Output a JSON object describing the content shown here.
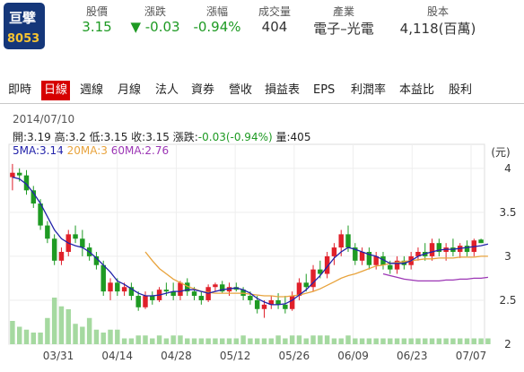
{
  "stock": {
    "name": "亘擘",
    "code": "8053"
  },
  "header": [
    {
      "label": "股價",
      "value": "3.15"
    },
    {
      "label": "漲跌",
      "value": "▼ -0.03"
    },
    {
      "label": "漲幅",
      "value": "-0.94%"
    },
    {
      "label": "成交量",
      "value": "404"
    },
    {
      "label": "產業",
      "value": "電子–光電"
    },
    {
      "label": "股本",
      "value": "4,118(百萬)"
    }
  ],
  "tabs": [
    "即時",
    "日線",
    "週線",
    "月線",
    "法人",
    "資券",
    "營收",
    "損益表",
    "EPS",
    "利潤率",
    "本益比",
    "股利"
  ],
  "active_tab": "日線",
  "ohlc": {
    "date": "2014/07/10",
    "line_open": "開:3.19",
    "line_high": "高:3.2",
    "line_low": "低:3.15",
    "line_close": "收:3.15",
    "line_change_label": "漲跌:",
    "line_change_value": "-0.03(-0.94%)",
    "line_volume": "量:405"
  },
  "ma": {
    "ma5": "5MA:3.14",
    "ma20": "20MA:3",
    "ma60": "60MA:2.76"
  },
  "colors": {
    "up": "#e0202a",
    "down": "#1e9a23",
    "ma5": "#2222aa",
    "ma20": "#e8a33c",
    "ma60": "#9c36b5",
    "volume": "#a5d9a0"
  },
  "chart_data": {
    "type": "candlestick",
    "unit_label": "(元)",
    "y_ticks": [
      "4",
      "3.5",
      "3",
      "2.5",
      "2"
    ],
    "ylim": [
      2,
      4.1
    ],
    "x_tick_labels": [
      "03/31",
      "04/14",
      "04/28",
      "05/12",
      "05/26",
      "06/09",
      "06/23",
      "07/07"
    ],
    "candles": [
      {
        "o": 3.9,
        "h": 4.05,
        "l": 3.75,
        "c": 3.95
      },
      {
        "o": 3.95,
        "h": 4.0,
        "l": 3.85,
        "c": 3.92
      },
      {
        "o": 3.92,
        "h": 3.98,
        "l": 3.7,
        "c": 3.75
      },
      {
        "o": 3.75,
        "h": 3.8,
        "l": 3.55,
        "c": 3.6
      },
      {
        "o": 3.6,
        "h": 3.65,
        "l": 3.3,
        "c": 3.35
      },
      {
        "o": 3.35,
        "h": 3.4,
        "l": 3.15,
        "c": 3.2
      },
      {
        "o": 3.2,
        "h": 3.25,
        "l": 2.9,
        "c": 2.95
      },
      {
        "o": 2.95,
        "h": 3.1,
        "l": 2.9,
        "c": 3.05
      },
      {
        "o": 3.05,
        "h": 3.3,
        "l": 3.0,
        "c": 3.25
      },
      {
        "o": 3.25,
        "h": 3.35,
        "l": 3.15,
        "c": 3.2
      },
      {
        "o": 3.2,
        "h": 3.3,
        "l": 3.0,
        "c": 3.1
      },
      {
        "o": 3.1,
        "h": 3.15,
        "l": 2.95,
        "c": 3.0
      },
      {
        "o": 3.0,
        "h": 3.05,
        "l": 2.85,
        "c": 2.9
      },
      {
        "o": 2.9,
        "h": 2.95,
        "l": 2.55,
        "c": 2.6
      },
      {
        "o": 2.6,
        "h": 2.75,
        "l": 2.5,
        "c": 2.7
      },
      {
        "o": 2.7,
        "h": 2.75,
        "l": 2.55,
        "c": 2.6
      },
      {
        "o": 2.6,
        "h": 2.7,
        "l": 2.55,
        "c": 2.65
      },
      {
        "o": 2.65,
        "h": 2.7,
        "l": 2.5,
        "c": 2.55
      },
      {
        "o": 2.55,
        "h": 2.6,
        "l": 2.38,
        "c": 2.42
      },
      {
        "o": 2.42,
        "h": 2.6,
        "l": 2.4,
        "c": 2.55
      },
      {
        "o": 2.55,
        "h": 2.6,
        "l": 2.45,
        "c": 2.5
      },
      {
        "o": 2.5,
        "h": 2.65,
        "l": 2.48,
        "c": 2.62
      },
      {
        "o": 2.62,
        "h": 2.7,
        "l": 2.55,
        "c": 2.6
      },
      {
        "o": 2.6,
        "h": 2.7,
        "l": 2.5,
        "c": 2.55
      },
      {
        "o": 2.55,
        "h": 2.72,
        "l": 2.5,
        "c": 2.7
      },
      {
        "o": 2.7,
        "h": 2.75,
        "l": 2.55,
        "c": 2.6
      },
      {
        "o": 2.6,
        "h": 2.65,
        "l": 2.5,
        "c": 2.55
      },
      {
        "o": 2.55,
        "h": 2.6,
        "l": 2.45,
        "c": 2.5
      },
      {
        "o": 2.5,
        "h": 2.68,
        "l": 2.48,
        "c": 2.65
      },
      {
        "o": 2.65,
        "h": 2.7,
        "l": 2.6,
        "c": 2.68
      },
      {
        "o": 2.68,
        "h": 2.72,
        "l": 2.58,
        "c": 2.6
      },
      {
        "o": 2.6,
        "h": 2.7,
        "l": 2.55,
        "c": 2.65
      },
      {
        "o": 2.65,
        "h": 2.7,
        "l": 2.6,
        "c": 2.62
      },
      {
        "o": 2.62,
        "h": 2.65,
        "l": 2.5,
        "c": 2.55
      },
      {
        "o": 2.55,
        "h": 2.6,
        "l": 2.45,
        "c": 2.5
      },
      {
        "o": 2.5,
        "h": 2.55,
        "l": 2.35,
        "c": 2.4
      },
      {
        "o": 2.4,
        "h": 2.5,
        "l": 2.3,
        "c": 2.45
      },
      {
        "o": 2.45,
        "h": 2.55,
        "l": 2.4,
        "c": 2.5
      },
      {
        "o": 2.5,
        "h": 2.58,
        "l": 2.4,
        "c": 2.45
      },
      {
        "o": 2.45,
        "h": 2.55,
        "l": 2.35,
        "c": 2.4
      },
      {
        "o": 2.4,
        "h": 2.6,
        "l": 2.38,
        "c": 2.55
      },
      {
        "o": 2.55,
        "h": 2.75,
        "l": 2.5,
        "c": 2.7
      },
      {
        "o": 2.7,
        "h": 2.8,
        "l": 2.6,
        "c": 2.65
      },
      {
        "o": 2.65,
        "h": 2.9,
        "l": 2.6,
        "c": 2.85
      },
      {
        "o": 2.85,
        "h": 2.95,
        "l": 2.75,
        "c": 2.8
      },
      {
        "o": 2.8,
        "h": 3.05,
        "l": 2.75,
        "c": 3.0
      },
      {
        "o": 3.0,
        "h": 3.15,
        "l": 2.9,
        "c": 3.1
      },
      {
        "o": 3.1,
        "h": 3.3,
        "l": 3.0,
        "c": 3.25
      },
      {
        "o": 3.25,
        "h": 3.35,
        "l": 3.05,
        "c": 3.1
      },
      {
        "o": 3.1,
        "h": 3.15,
        "l": 2.9,
        "c": 2.95
      },
      {
        "o": 2.95,
        "h": 3.1,
        "l": 2.9,
        "c": 3.05
      },
      {
        "o": 3.05,
        "h": 3.1,
        "l": 2.85,
        "c": 2.9
      },
      {
        "o": 2.9,
        "h": 3.05,
        "l": 2.85,
        "c": 3.0
      },
      {
        "o": 3.0,
        "h": 3.05,
        "l": 2.85,
        "c": 2.9
      },
      {
        "o": 2.9,
        "h": 2.95,
        "l": 2.8,
        "c": 2.85
      },
      {
        "o": 2.85,
        "h": 3.0,
        "l": 2.8,
        "c": 2.95
      },
      {
        "o": 2.95,
        "h": 3.0,
        "l": 2.85,
        "c": 2.9
      },
      {
        "o": 2.9,
        "h": 3.05,
        "l": 2.85,
        "c": 3.0
      },
      {
        "o": 3.0,
        "h": 3.1,
        "l": 2.95,
        "c": 3.05
      },
      {
        "o": 3.05,
        "h": 3.15,
        "l": 2.95,
        "c": 3.0
      },
      {
        "o": 3.0,
        "h": 3.2,
        "l": 2.95,
        "c": 3.15
      },
      {
        "o": 3.15,
        "h": 3.2,
        "l": 3.0,
        "c": 3.05
      },
      {
        "o": 3.05,
        "h": 3.15,
        "l": 2.95,
        "c": 3.1
      },
      {
        "o": 3.1,
        "h": 3.2,
        "l": 3.0,
        "c": 3.05
      },
      {
        "o": 3.05,
        "h": 3.15,
        "l": 2.98,
        "c": 3.12
      },
      {
        "o": 3.12,
        "h": 3.18,
        "l": 3.0,
        "c": 3.05
      },
      {
        "o": 3.05,
        "h": 3.2,
        "l": 3.0,
        "c": 3.18
      },
      {
        "o": 3.19,
        "h": 3.2,
        "l": 3.15,
        "c": 3.15
      }
    ],
    "ma5": [
      3.9,
      3.88,
      3.82,
      3.72,
      3.6,
      3.45,
      3.3,
      3.2,
      3.15,
      3.12,
      3.1,
      3.05,
      2.98,
      2.9,
      2.82,
      2.72,
      2.68,
      2.63,
      2.58,
      2.55,
      2.55,
      2.56,
      2.58,
      2.6,
      2.6,
      2.62,
      2.62,
      2.6,
      2.58,
      2.6,
      2.62,
      2.63,
      2.64,
      2.62,
      2.58,
      2.52,
      2.48,
      2.45,
      2.45,
      2.46,
      2.5,
      2.56,
      2.62,
      2.7,
      2.78,
      2.88,
      2.98,
      3.05,
      3.1,
      3.08,
      3.05,
      3.02,
      3.0,
      2.96,
      2.92,
      2.92,
      2.92,
      2.95,
      3.0,
      3.03,
      3.05,
      3.07,
      3.08,
      3.08,
      3.09,
      3.1,
      3.11,
      3.12,
      3.14
    ],
    "ma20": [
      null,
      null,
      null,
      null,
      null,
      null,
      null,
      null,
      null,
      null,
      null,
      null,
      null,
      null,
      null,
      null,
      null,
      null,
      null,
      3.05,
      2.95,
      2.86,
      2.8,
      2.74,
      2.7,
      2.66,
      2.63,
      2.6,
      2.59,
      2.58,
      2.58,
      2.58,
      2.58,
      2.58,
      2.57,
      2.56,
      2.55,
      2.55,
      2.54,
      2.54,
      2.55,
      2.56,
      2.58,
      2.6,
      2.63,
      2.67,
      2.71,
      2.75,
      2.78,
      2.8,
      2.83,
      2.86,
      2.89,
      2.9,
      2.92,
      2.93,
      2.94,
      2.95,
      2.96,
      2.97,
      2.97,
      2.98,
      2.98,
      2.98,
      2.99,
      2.99,
      2.99,
      3.0,
      3.0
    ],
    "ma60": [
      null,
      null,
      null,
      null,
      null,
      null,
      null,
      null,
      null,
      null,
      null,
      null,
      null,
      null,
      null,
      null,
      null,
      null,
      null,
      null,
      null,
      null,
      null,
      null,
      null,
      null,
      null,
      null,
      null,
      null,
      null,
      null,
      null,
      null,
      null,
      null,
      null,
      null,
      null,
      null,
      null,
      null,
      null,
      null,
      null,
      null,
      null,
      null,
      null,
      null,
      null,
      null,
      null,
      2.8,
      2.78,
      2.76,
      2.74,
      2.73,
      2.72,
      2.72,
      2.72,
      2.72,
      2.73,
      2.73,
      2.74,
      2.74,
      2.75,
      2.75,
      2.76
    ],
    "volume": [
      8,
      6,
      5,
      4,
      4,
      9,
      16,
      13,
      12,
      7,
      6,
      9,
      5,
      4,
      5,
      5,
      2,
      2,
      3,
      3,
      2,
      3,
      2,
      3,
      3,
      2,
      2,
      2,
      2,
      2,
      2,
      2,
      2,
      3,
      2,
      2,
      2,
      2,
      3,
      2,
      3,
      3,
      2,
      3,
      3,
      3,
      2,
      2,
      3,
      2,
      2,
      2,
      2,
      2,
      2,
      2,
      2,
      2,
      2,
      2,
      2,
      2,
      2,
      2,
      2,
      2,
      2,
      2,
      2
    ]
  }
}
